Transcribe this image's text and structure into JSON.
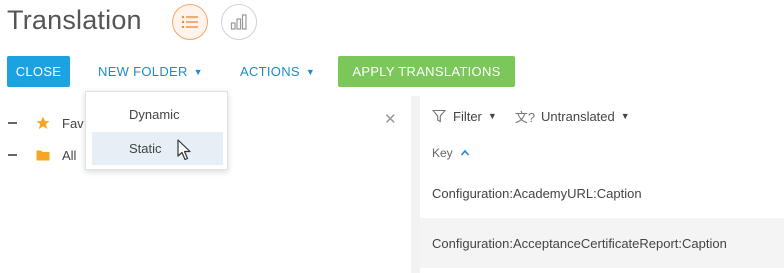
{
  "header": {
    "title": "Translation"
  },
  "toolbar": {
    "close_label": "CLOSE",
    "new_folder_label": "NEW FOLDER",
    "actions_label": "ACTIONS",
    "apply_label": "APPLY TRANSLATIONS"
  },
  "folder_menu": {
    "items": [
      {
        "label": "Dynamic"
      },
      {
        "label": "Static"
      }
    ]
  },
  "tree": {
    "items": [
      {
        "label": "Fav"
      },
      {
        "label": "All"
      }
    ]
  },
  "filters": {
    "filter_label": "Filter",
    "untranslated_label": "Untranslated"
  },
  "table": {
    "key_header": "Key",
    "rows": [
      {
        "key": "Configuration:AcademyURL:Caption"
      },
      {
        "key": "Configuration:AcceptanceCertificateReport:Caption"
      }
    ]
  },
  "colors": {
    "primary": "#1aa3e0",
    "apply": "#7bc75a",
    "accent": "#f7a56b",
    "link": "#1b8ccf"
  }
}
